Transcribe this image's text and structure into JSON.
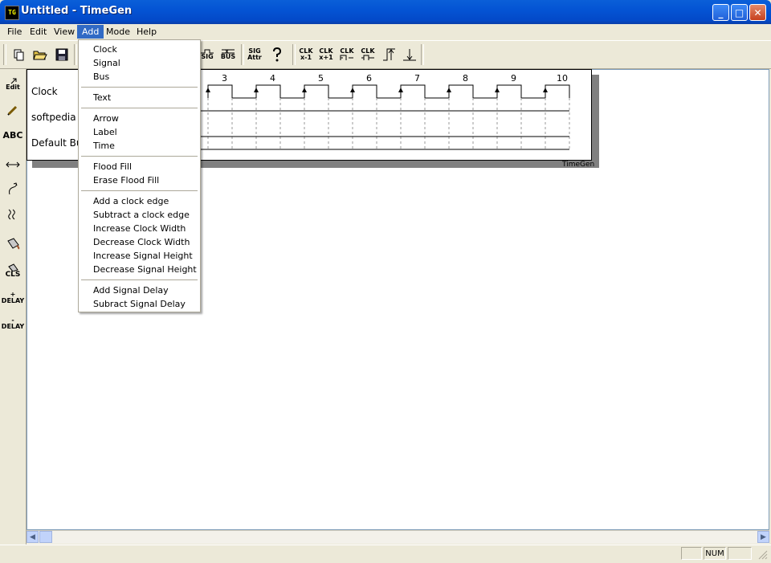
{
  "window": {
    "title": "Untitled - TimeGen",
    "app_icon_text": "TG"
  },
  "menubar": [
    {
      "label": "File"
    },
    {
      "label": "Edit"
    },
    {
      "label": "View"
    },
    {
      "label": "Add",
      "active": true
    },
    {
      "label": "Mode"
    },
    {
      "label": "Help"
    }
  ],
  "toolbar": {
    "buttons": [
      {
        "name": "new",
        "icon": "new-file-icon"
      },
      {
        "name": "open",
        "icon": "open-folder-icon"
      },
      {
        "name": "save",
        "icon": "save-icon"
      },
      {
        "name": "add-signal",
        "text": "SIG"
      },
      {
        "name": "add-bus",
        "text": "BUS"
      },
      {
        "name": "signal-attributes",
        "text": "SIG Attr"
      },
      {
        "name": "help",
        "icon": "help-icon"
      },
      {
        "name": "clk-shift-left",
        "text": "CLK x-1"
      },
      {
        "name": "clk-shift-right",
        "text": "CLK x+1"
      },
      {
        "name": "clk-widen",
        "text": "CLK"
      },
      {
        "name": "clk-narrow",
        "text": "CLK"
      },
      {
        "name": "signal-height-up",
        "icon": "signal-up-icon"
      },
      {
        "name": "signal-height-down",
        "icon": "signal-down-icon"
      }
    ]
  },
  "leftbar": {
    "buttons": [
      {
        "name": "edit",
        "text": "Edit"
      },
      {
        "name": "pencil",
        "icon": "pencil-icon"
      },
      {
        "name": "text",
        "text": "ABC"
      },
      {
        "name": "arrow",
        "icon": "double-arrow-icon"
      },
      {
        "name": "curve",
        "icon": "curve-arrow-icon"
      },
      {
        "name": "break",
        "icon": "break-icon"
      },
      {
        "name": "flood-fill",
        "icon": "paint-bucket-icon"
      },
      {
        "name": "erase-fill",
        "text": "CLS"
      },
      {
        "name": "add-delay",
        "text": "+ DELAY"
      },
      {
        "name": "sub-delay",
        "text": "- DELAY"
      }
    ]
  },
  "diagram": {
    "signals": [
      {
        "label": "Clock"
      },
      {
        "label": "softpedia"
      },
      {
        "label": "Default Bus"
      }
    ],
    "clock_numbers": [
      "3",
      "4",
      "5",
      "6",
      "7",
      "8",
      "9",
      "10"
    ],
    "watermark": "TimeGen"
  },
  "add_menu": {
    "groups": [
      [
        "Clock",
        "Signal",
        "Bus"
      ],
      [
        "Text"
      ],
      [
        "Arrow",
        "Label",
        "Time"
      ],
      [
        "Flood Fill",
        "Erase Flood Fill"
      ],
      [
        "Add a clock edge",
        "Subtract a clock edge",
        "Increase Clock Width",
        "Decrease Clock Width",
        "Increase Signal Height",
        "Decrease Signal Height"
      ],
      [
        "Add Signal Delay",
        "Subract Signal Delay"
      ]
    ]
  },
  "statusbar": {
    "num": "NUM"
  }
}
